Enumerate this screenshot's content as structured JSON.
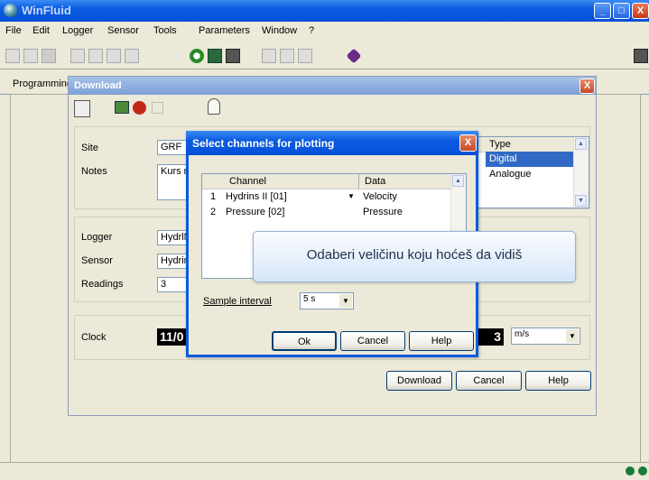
{
  "app": {
    "title": "WinFluid"
  },
  "menu": {
    "items": [
      "File",
      "Edit",
      "Logger",
      "Sensor",
      "Tools",
      "Parameters",
      "Window",
      "?"
    ]
  },
  "tabs": {
    "programming": "Programming"
  },
  "download": {
    "title": "Download",
    "site_label": "Site",
    "site_value": "GRF",
    "notes_label": "Notes",
    "notes_value": "Kurs m",
    "type_header": "Type",
    "type_items": [
      "Digital",
      "Analogue"
    ],
    "logger_label": "Logger",
    "logger_value": "HydrlN",
    "sensor_label": "Sensor",
    "sensor_value": "Hydrins",
    "readings_label": "Readings",
    "readings_value": "3",
    "clock_label": "Clock",
    "clock_value": "11/0",
    "clock_tail": "3",
    "unit_value": "m/s",
    "download_button": "Download",
    "cancel_button": "Cancel",
    "help_button": "Help"
  },
  "select_dialog": {
    "title": "Select channels for plotting",
    "col_channel": "Channel",
    "col_data": "Data",
    "rows": [
      {
        "num": "1",
        "channel": "Hydrins II  [01]",
        "data": "Velocity"
      },
      {
        "num": "2",
        "channel": "Pressure  [02]",
        "data": "Pressure"
      }
    ],
    "interval_label": "Sample interval",
    "interval_value": "5 s",
    "ok_button": "Ok",
    "cancel_button": "Cancel",
    "help_button": "Help"
  },
  "tooltip": {
    "text": "Odaberi veličinu koju hoćeš da vidiš"
  },
  "colors": {
    "title_blue": "#0a5ce0",
    "selection": "#316ac5"
  }
}
